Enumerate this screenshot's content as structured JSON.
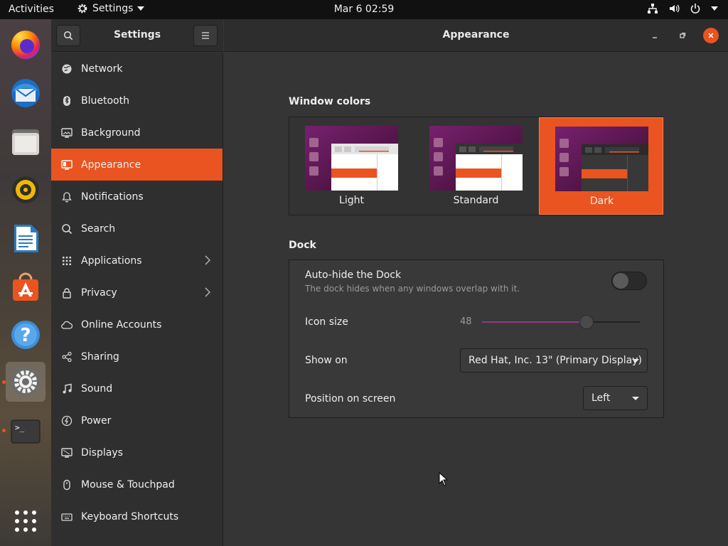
{
  "topbar": {
    "activities": "Activities",
    "app_name": "Settings",
    "clock": "Mar 6  02:59",
    "tray_icons": [
      "network-wired-icon",
      "volume-icon",
      "power-icon",
      "chevron-down-icon"
    ]
  },
  "dock": {
    "apps": [
      {
        "name": "firefox-icon"
      },
      {
        "name": "thunderbird-icon"
      },
      {
        "name": "files-icon"
      },
      {
        "name": "rhythmbox-icon"
      },
      {
        "name": "libreoffice-writer-icon"
      },
      {
        "name": "software-icon"
      },
      {
        "name": "help-icon"
      },
      {
        "name": "settings-icon",
        "active": true
      },
      {
        "name": "terminal-icon"
      },
      {
        "name": "show-applications-icon"
      }
    ]
  },
  "window": {
    "sidebar_title": "Settings",
    "main_title": "Appearance"
  },
  "sidebar": {
    "items": [
      {
        "label": "Network",
        "icon": "network-icon"
      },
      {
        "label": "Bluetooth",
        "icon": "bluetooth-icon"
      },
      {
        "label": "Background",
        "icon": "background-icon"
      },
      {
        "label": "Appearance",
        "icon": "appearance-icon",
        "selected": true
      },
      {
        "label": "Notifications",
        "icon": "bell-icon"
      },
      {
        "label": "Search",
        "icon": "search-icon"
      },
      {
        "label": "Applications",
        "icon": "apps-grid-icon",
        "chevron": true
      },
      {
        "label": "Privacy",
        "icon": "lock-icon",
        "chevron": true
      },
      {
        "label": "Online Accounts",
        "icon": "cloud-icon"
      },
      {
        "label": "Sharing",
        "icon": "share-icon"
      },
      {
        "label": "Sound",
        "icon": "music-note-icon"
      },
      {
        "label": "Power",
        "icon": "power-icon"
      },
      {
        "label": "Displays",
        "icon": "display-icon"
      },
      {
        "label": "Mouse & Touchpad",
        "icon": "mouse-icon"
      },
      {
        "label": "Keyboard Shortcuts",
        "icon": "keyboard-icon"
      }
    ]
  },
  "appearance": {
    "window_colors_title": "Window colors",
    "options": [
      {
        "label": "Light",
        "selected": false
      },
      {
        "label": "Standard",
        "selected": false
      },
      {
        "label": "Dark",
        "selected": true
      }
    ],
    "dock_title": "Dock",
    "autohide_label": "Auto-hide the Dock",
    "autohide_sub": "The dock hides when any windows overlap with it.",
    "autohide_on": false,
    "icon_size_label": "Icon size",
    "icon_size_value": "48",
    "show_on_label": "Show on",
    "show_on_value": "Red Hat, Inc. 13\" (Primary Display)",
    "position_label": "Position on screen",
    "position_value": "Left"
  },
  "colors": {
    "accent": "#e95420",
    "aubergine": "#5e1f4a"
  }
}
